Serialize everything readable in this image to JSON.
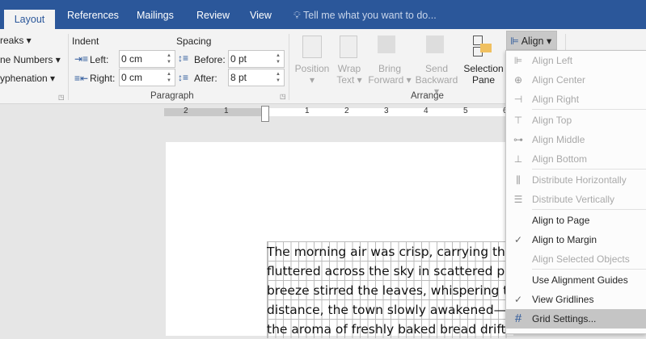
{
  "tabs": [
    "Layout",
    "References",
    "Mailings",
    "Review",
    "View"
  ],
  "tell_me": "Tell me what you want to do...",
  "page_setup": {
    "breaks": "reaks",
    "line_numbers": "ne Numbers",
    "hyphenation": "yphenation"
  },
  "paragraph": {
    "indent_label": "Indent",
    "spacing_label": "Spacing",
    "left_label": "Left:",
    "left_value": "0 cm",
    "right_label": "Right:",
    "right_value": "0 cm",
    "before_label": "Before:",
    "before_value": "0 pt",
    "after_label": "After:",
    "after_value": "8 pt",
    "group_label": "Paragraph"
  },
  "arrange": {
    "position": "Position",
    "wrap1": "Wrap",
    "wrap2": "Text",
    "bring1": "Bring",
    "bring2": "Forward",
    "send1": "Send",
    "send2": "Backward",
    "sel1": "Selection",
    "sel2": "Pane",
    "group_label": "Arrange",
    "align": "Align"
  },
  "ruler": [
    "2",
    "1",
    "1",
    "2",
    "3",
    "4",
    "5",
    "6"
  ],
  "document_lines": [
    "The morning air was crisp, carrying the scent of",
    "fluttered across the sky in scattered patterns",
    "breeze stirred the leaves, whispering tales",
    "distance, the town slowly awakened—",
    "the aroma of freshly baked bread drifted from the bakery"
  ],
  "menu": [
    {
      "label": "Align Left",
      "icon": "align-left-icon",
      "disabled": true
    },
    {
      "label": "Align Center",
      "icon": "align-center-icon",
      "disabled": true
    },
    {
      "label": "Align Right",
      "icon": "align-right-icon",
      "disabled": true,
      "sep": true
    },
    {
      "label": "Align Top",
      "icon": "align-top-icon",
      "disabled": true
    },
    {
      "label": "Align Middle",
      "icon": "align-middle-icon",
      "disabled": true
    },
    {
      "label": "Align Bottom",
      "icon": "align-bottom-icon",
      "disabled": true,
      "sep": true
    },
    {
      "label": "Distribute Horizontally",
      "icon": "distribute-horizontally-icon",
      "disabled": true
    },
    {
      "label": "Distribute Vertically",
      "icon": "distribute-vertically-icon",
      "disabled": true,
      "sep": true
    },
    {
      "label": "Align to Page",
      "disabled": false
    },
    {
      "label": "Align to Margin",
      "disabled": false,
      "checked": true
    },
    {
      "label": "Align Selected Objects",
      "disabled": true,
      "sep": true
    },
    {
      "label": "Use Alignment Guides",
      "disabled": false
    },
    {
      "label": "View Gridlines",
      "disabled": false,
      "checked": true
    },
    {
      "label": "Grid Settings...",
      "icon": "grid-icon",
      "disabled": false,
      "highlighted": true
    }
  ],
  "colors": {
    "brand": "#2b579a"
  }
}
